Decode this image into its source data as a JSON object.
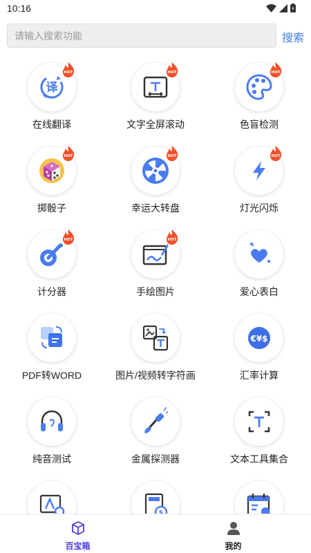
{
  "status_bar": {
    "time": "10:16"
  },
  "search": {
    "placeholder": "请输入搜索功能",
    "button_label": "搜索"
  },
  "tools": [
    {
      "label": "在线翻译",
      "icon": "translate-icon",
      "hot": true
    },
    {
      "label": "文字全屏滚动",
      "icon": "text-scroll-icon",
      "hot": true
    },
    {
      "label": "色盲检测",
      "icon": "palette-icon",
      "hot": true
    },
    {
      "label": "掷骰子",
      "icon": "dice-icon",
      "hot": true
    },
    {
      "label": "幸运大转盘",
      "icon": "wheel-icon",
      "hot": true
    },
    {
      "label": "灯光闪烁",
      "icon": "lightning-icon",
      "hot": true
    },
    {
      "label": "计分器",
      "icon": "counter-icon",
      "hot": true
    },
    {
      "label": "手绘图片",
      "icon": "draw-icon",
      "hot": true
    },
    {
      "label": "爱心表白",
      "icon": "hearts-icon",
      "hot": false
    },
    {
      "label": "PDF转WORD",
      "icon": "pdf-word-icon",
      "hot": false
    },
    {
      "label": "图片/视频转字符画",
      "icon": "image-to-text-icon",
      "hot": false
    },
    {
      "label": "汇率计算",
      "icon": "exchange-icon",
      "hot": false
    },
    {
      "label": "纯音测试",
      "icon": "headphones-icon",
      "hot": false
    },
    {
      "label": "金属探测器",
      "icon": "metal-detector-icon",
      "hot": false
    },
    {
      "label": "文本工具集合",
      "icon": "text-tools-icon",
      "hot": false
    },
    {
      "label": "",
      "icon": "font-settings-icon",
      "hot": false
    },
    {
      "label": "",
      "icon": "calculator-money-icon",
      "hot": false
    },
    {
      "label": "",
      "icon": "calendar-icon",
      "hot": false
    }
  ],
  "bottom_nav": [
    {
      "label": "百宝箱",
      "icon": "box-icon",
      "active": true
    },
    {
      "label": "我的",
      "icon": "user-icon",
      "active": false
    }
  ],
  "colors": {
    "accent": "#3f7bf2",
    "icon_blue": "#4a7bf0",
    "nav_active": "#4a3fe0",
    "hot_red": "#f0502a"
  }
}
